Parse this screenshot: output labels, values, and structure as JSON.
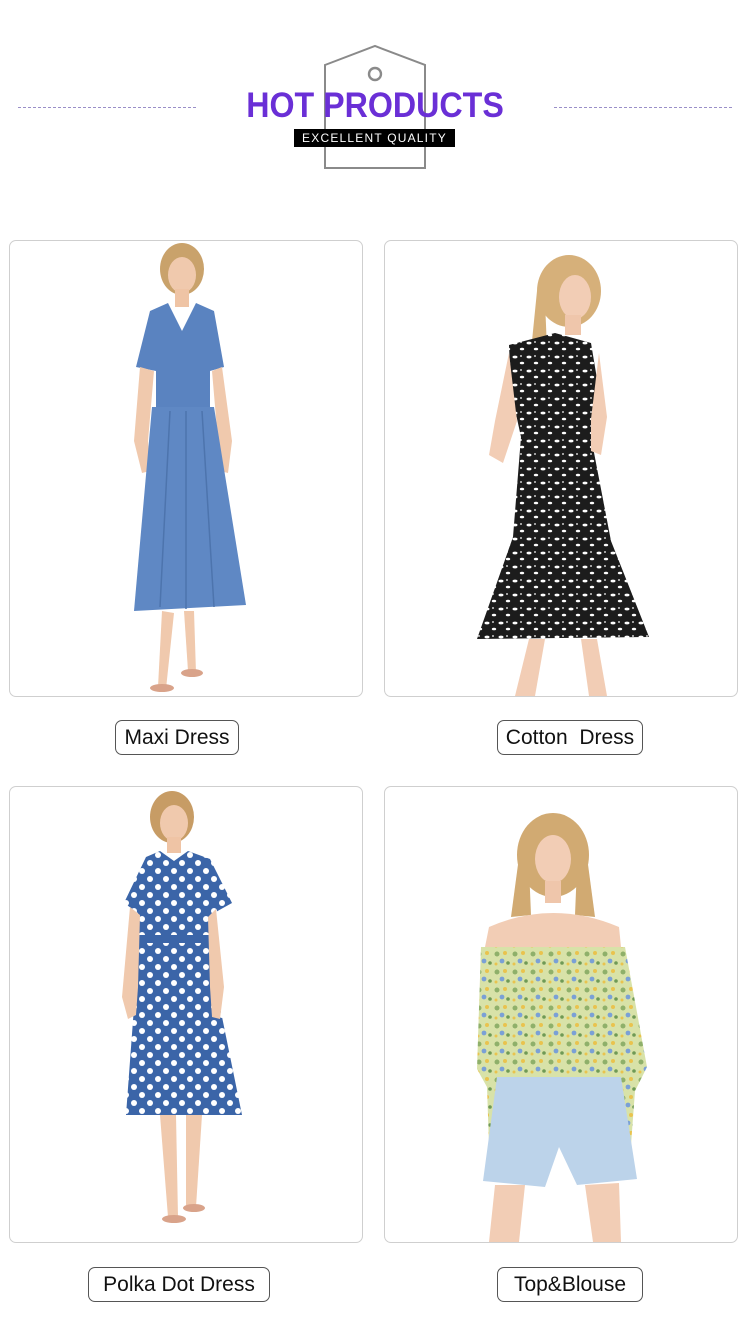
{
  "header": {
    "title": "HOT PRODUCTS",
    "subtitle": "EXCELLENT QUALITY",
    "title_color": "#6a2fd6",
    "tag_icon": "price-tag-outline-icon"
  },
  "products": [
    {
      "label": "Maxi Dress",
      "image": "model-blue-chambray-maxi-skirt-set",
      "dress_color": "#5a83c0"
    },
    {
      "label": "Cotton  Dress",
      "image": "model-black-floral-shirt-dress",
      "dress_color": "#1c1c1c"
    },
    {
      "label": "Polka Dot Dress",
      "image": "model-blue-polka-dot-midi-dress",
      "dress_color": "#3b65a8"
    },
    {
      "label": "Top&Blouse",
      "image": "model-green-floral-off-shoulder-blouse",
      "dress_color": "#b8cf8a"
    }
  ]
}
